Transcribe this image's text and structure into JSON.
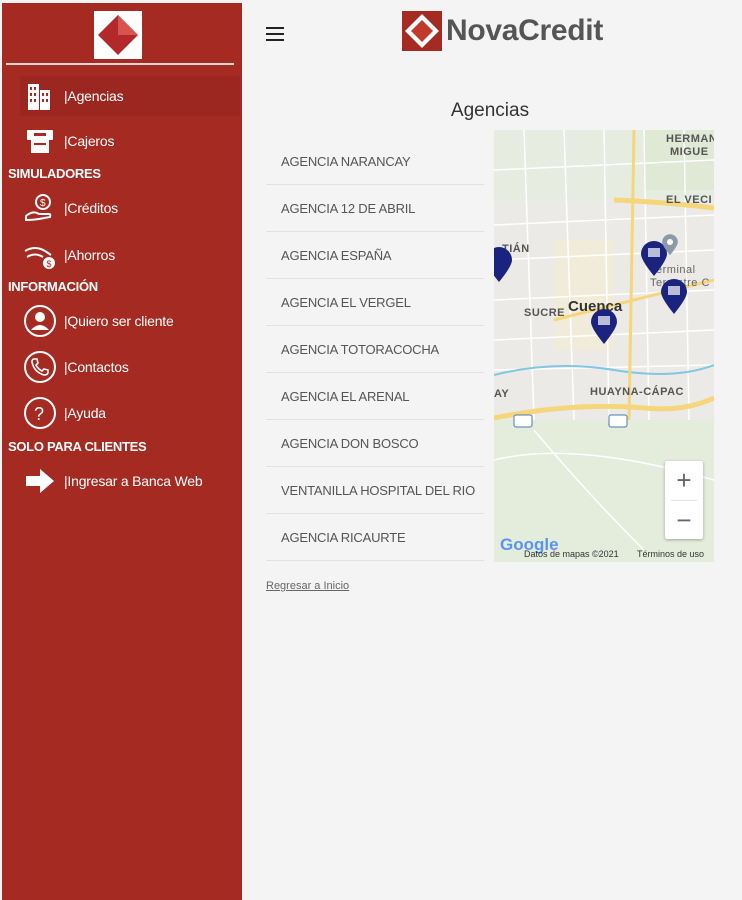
{
  "sidebar": {
    "items": [
      {
        "label": "|Agencias",
        "icon": "building-icon"
      },
      {
        "label": "|Cajeros",
        "icon": "atm-icon"
      },
      {
        "label": "|Créditos",
        "icon": "credit-hand-icon"
      },
      {
        "label": "|Ahorros",
        "icon": "savings-coin-icon"
      },
      {
        "label": "|Quiero ser cliente",
        "icon": "user-icon"
      },
      {
        "label": "|Contactos",
        "icon": "phone-icon"
      },
      {
        "label": "|Ayuda",
        "icon": "help-icon"
      },
      {
        "label": "|Ingresar a Banca Web",
        "icon": "arrow-right-icon"
      }
    ],
    "sections": {
      "simuladores": "SIMULADORES",
      "informacion": "INFORMACIÓN",
      "clientes": "SOLO PARA CLIENTES"
    }
  },
  "header": {
    "brand": "NovaCredit"
  },
  "main": {
    "title": "Agencias",
    "agencies": [
      "AGENCIA NARANCAY",
      "AGENCIA 12 DE ABRIL",
      "AGENCIA ESPAÑA",
      "AGENCIA EL VERGEL",
      "AGENCIA TOTORACOCHA",
      "AGENCIA EL ARENAL",
      "AGENCIA DON BOSCO",
      "VENTANILLA HOSPITAL DEL RIO",
      "AGENCIA RICAURTE"
    ],
    "back_link": "Regresar a Inicio"
  },
  "map": {
    "labels": {
      "hermano": "HERMAN",
      "miguel": "MIGUE",
      "vecino": "EL VECI",
      "sebastian": "TIÁN",
      "cuenca": "Cuenca",
      "sucre": "SUCRE",
      "huayna": "HUAYNA-CÁPAC",
      "ay": "AY",
      "terminal": "Terminal",
      "terminal2": "Terrestre C"
    },
    "zoom_in": "+",
    "zoom_out": "−",
    "google": "Google",
    "attribution": "Datos de mapas ©2021",
    "terms": "Términos de uso"
  },
  "colors": {
    "sidebar": "#a52a22",
    "accent": "#c0392b",
    "pin": "#1a237e"
  }
}
